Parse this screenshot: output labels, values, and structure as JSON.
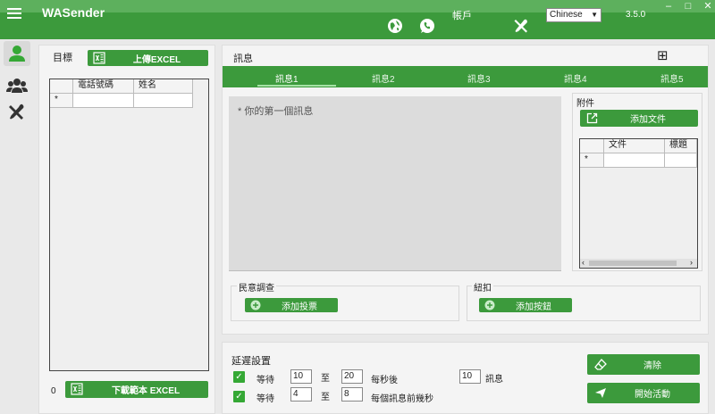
{
  "window": {
    "minimize": "–",
    "maximize": "□",
    "close": "✕"
  },
  "header": {
    "title": "WASender",
    "account_label": "帳戶",
    "language": "Chinese",
    "version": "3.5.0"
  },
  "targets": {
    "title": "目標",
    "upload_excel": "上傳EXCEL",
    "columns": [
      "電話號碼",
      "姓名"
    ],
    "new_row_marker": "*",
    "count": "0",
    "download_template": "下載範本 EXCEL"
  },
  "message": {
    "title": "訊息",
    "add_icon": "⊞",
    "tabs": [
      "訊息1",
      "訊息2",
      "訊息3",
      "訊息4",
      "訊息5"
    ],
    "placeholder": "* 你的第一個訊息",
    "attachments": {
      "title": "附件",
      "add_file": "添加文件",
      "columns": [
        "文件",
        "標題"
      ],
      "new_row_marker": "*"
    },
    "poll": {
      "title": "民意調查",
      "add_poll": "添加投票"
    },
    "buttons": {
      "title": "紐扣",
      "add_button": "添加按鈕"
    }
  },
  "delay": {
    "title": "延遲設置",
    "row1": {
      "wait": "等待",
      "from": "10",
      "to_label": "至",
      "to": "20",
      "suffix": "每秒後",
      "count": "10",
      "unit": "訊息"
    },
    "row2": {
      "wait": "等待",
      "from": "4",
      "to_label": "至",
      "to": "8",
      "suffix": "每個訊息前幾秒"
    },
    "clear": "清除",
    "start": "開始活動"
  },
  "colors": {
    "header": "#3c9a3c",
    "accent": "#35a835",
    "chrome": "#5db05d"
  }
}
